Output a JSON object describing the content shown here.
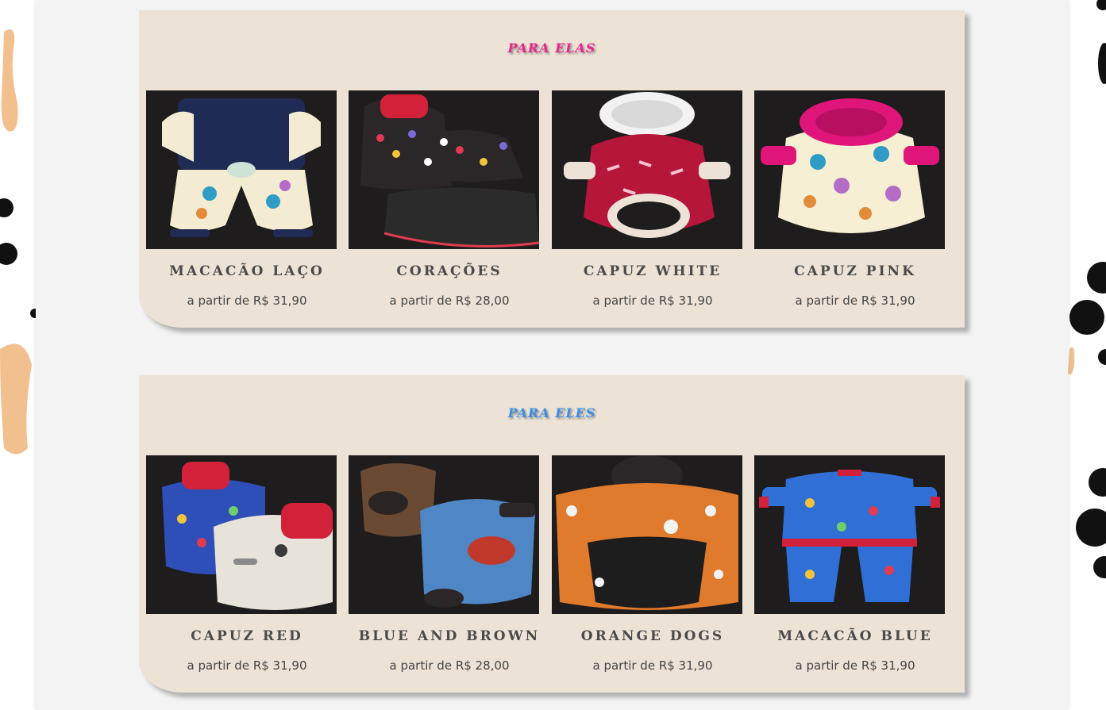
{
  "sections": [
    {
      "title": "PARA ELAS",
      "title_color": "#e8268f",
      "products": [
        {
          "name": "MACACÃO LAÇO",
          "price": "a partir de R$ 31,90",
          "image": "jumpsuit-bow-photo"
        },
        {
          "name": "CORAÇÕES",
          "price": "a partir de R$ 28,00",
          "image": "hearts-dress-photo"
        },
        {
          "name": "CAPUZ WHITE",
          "price": "a partir de R$ 31,90",
          "image": "red-hoodie-photo"
        },
        {
          "name": "CAPUZ PINK",
          "price": "a partir de R$ 31,90",
          "image": "pink-fur-hoodie-photo"
        }
      ]
    },
    {
      "title": "PARA ELES",
      "title_color": "#3b8fe8",
      "products": [
        {
          "name": "CAPUZ RED",
          "price": "a partir de R$ 31,90",
          "image": "red-hood-sweaters-photo"
        },
        {
          "name": "BLUE AND BROWN",
          "price": "a partir de R$ 28,00",
          "image": "blue-brown-sweaters-photo"
        },
        {
          "name": "ORANGE DOGS",
          "price": "a partir de R$ 31,90",
          "image": "orange-dogs-hoodie-photo"
        },
        {
          "name": "MACACÃO BLUE",
          "price": "a partir de R$ 31,90",
          "image": "blue-jumpsuit-photo"
        }
      ]
    }
  ],
  "colors": {
    "panel_bg": "#ece3d6",
    "photo_bg": "#1e1c1d",
    "page_bg": "#f3f3f3"
  }
}
